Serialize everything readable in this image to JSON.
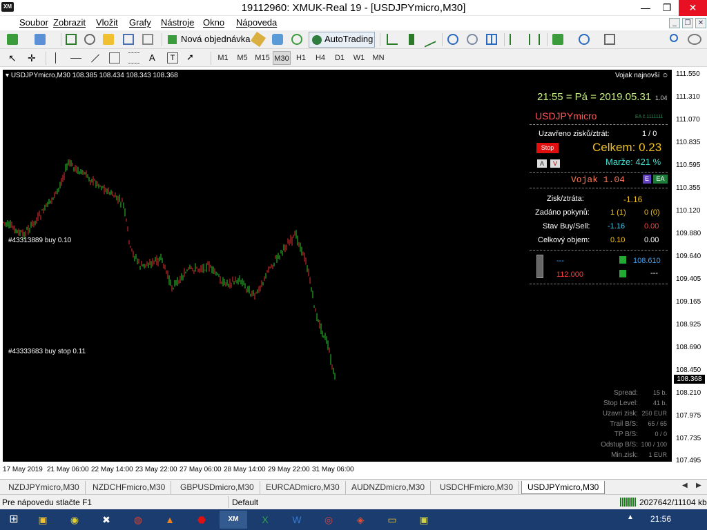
{
  "window": {
    "logo": "XM",
    "title": "19112960: XMUK-Real 19 - [USDJPYmicro,M30]",
    "minimize": "—",
    "maximize": "❐",
    "close": "✕"
  },
  "menu": [
    "Soubor",
    "Zobrazit",
    "Vložit",
    "Grafy",
    "Nástroje",
    "Okno",
    "Nápoveda"
  ],
  "toolbar": {
    "new_order_label": "Nová objednávka",
    "autotrading_label": "AutoTrading",
    "timeframes": [
      "M1",
      "M5",
      "M15",
      "M30",
      "H1",
      "H4",
      "D1",
      "W1",
      "MN"
    ],
    "active_timeframe": "M30"
  },
  "chart": {
    "header": "USDJPYmicro,M30  108.385 108.434 108.343 108.368",
    "top_right_label": "Vojak najnovší",
    "order_labels": [
      "#43313889 buy 0.10",
      "#43333683 buy stop 0.11"
    ],
    "price_ticks": [
      "111.550",
      "111.310",
      "111.070",
      "110.835",
      "110.595",
      "110.355",
      "110.120",
      "109.880",
      "109.640",
      "109.405",
      "109.165",
      "108.925",
      "108.690",
      "108.450",
      "108.210",
      "107.975",
      "107.735",
      "107.495"
    ],
    "current_price": "108.368",
    "time_ticks": [
      "17 May 2019",
      "21 May 06:00",
      "22 May 14:00",
      "23 May 22:00",
      "27 May 06:00",
      "28 May 14:00",
      "29 May 22:00",
      "31 May 06:00"
    ],
    "up_color": "#2ecc2e",
    "down_color": "#e53030"
  },
  "panel": {
    "clock": "21:55 = Pá = 2019.05.31",
    "clock_version": "1.04",
    "symbol": "USDJPYmicro",
    "ea_id": "EA č.1111111",
    "closed_label": "Uzavřeno zisků/ztrát:",
    "closed_value": "1 / 0",
    "stop_button": "Stop",
    "celkem": "Celkem: 0.23",
    "marze": "Marže:  421 %",
    "btn_a": "A",
    "btn_v": "V",
    "vojak": "Vojak 1.04",
    "badge_e": "E",
    "badge_ea": "EA",
    "rows": [
      {
        "label": "Zisk/ztráta:",
        "v1": "-1.16",
        "v2": ""
      },
      {
        "label": "Zadáno pokynů:",
        "v1": "1 (1)",
        "v2": "0 (0)"
      },
      {
        "label": "Stav Buy/Sell:",
        "v1": "-1.16",
        "v2": "0.00"
      },
      {
        "label": "Celkový objem:",
        "v1": "0.10",
        "v2": "0.00"
      }
    ],
    "levels": {
      "a1": "---",
      "a2": "108.610",
      "b1": "112.000",
      "b2": "---"
    },
    "stats": [
      {
        "label": "Spread:",
        "value": "15 b."
      },
      {
        "label": "Stop Level:",
        "value": "41 b."
      },
      {
        "label": "Uzavri zisk:",
        "value": "250 EUR"
      },
      {
        "label": "Trail B/S:",
        "value": "65 / 65"
      },
      {
        "label": "TP B/S:",
        "value": "0 / 0"
      },
      {
        "label": "Odstup B/S:",
        "value": "100 / 100"
      },
      {
        "label": "Min.zisk:",
        "value": "1 EUR"
      }
    ]
  },
  "tabs": [
    "NZDJPYmicro,M30",
    "NZDCHFmicro,M30",
    "GBPUSDmicro,M30",
    "EURCADmicro,M30",
    "AUDNZDmicro,M30",
    "USDCHFmicro,M30",
    "USDJPYmicro,M30"
  ],
  "active_tab": "USDJPYmicro,M30",
  "status": {
    "help": "Pre nápovedu stlačte F1",
    "profile": "Default",
    "traffic": "2027642/11104 kb"
  },
  "taskbar": {
    "time": "21:56",
    "apps": [
      "start",
      "folder",
      "chrome-like",
      "excel-like",
      "chrome",
      "vlc",
      "stop",
      "xm",
      "excel",
      "word",
      "app",
      "app2",
      "explorer",
      "app3"
    ]
  }
}
